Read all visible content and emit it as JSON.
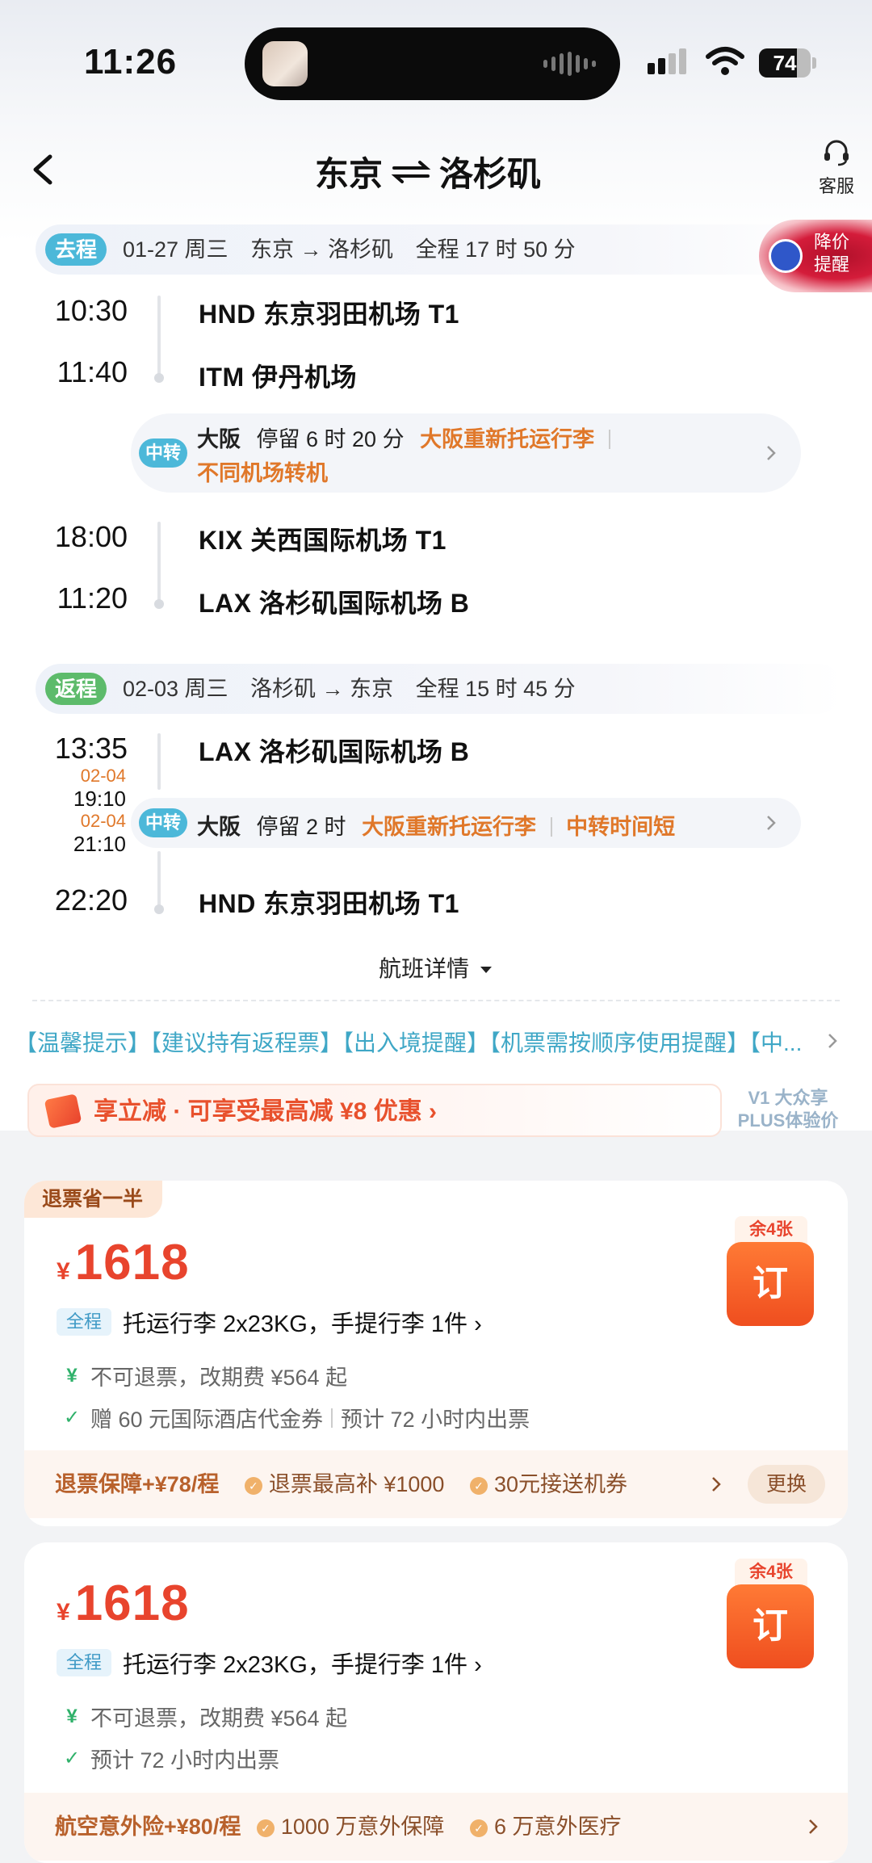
{
  "status": {
    "time": "11:26",
    "battery": "74",
    "battery_level_pct": 74
  },
  "header": {
    "from": "东京",
    "to": "洛杉矶",
    "service_label": "客服"
  },
  "outbound": {
    "badge": "去程",
    "date": "01-27 周三",
    "route": "东京 → 洛杉矶",
    "duration": "全程 17 时 50 分",
    "price_alert": "降价提醒",
    "stops": [
      {
        "time": "10:30",
        "airport": "HND 东京羽田机场 T1"
      },
      {
        "time": "11:40",
        "airport": "ITM 伊丹机场"
      },
      {
        "time": "18:00",
        "airport": "KIX 关西国际机场 T1"
      },
      {
        "time": "11:20",
        "airport": "LAX 洛杉矶国际机场 B"
      }
    ],
    "transfer": {
      "badge": "中转",
      "city": "大阪",
      "stay": "停留 6 时 20 分",
      "note1": "大阪重新托运行李",
      "note2": "不同机场转机"
    }
  },
  "inbound": {
    "badge": "返程",
    "date": "02-03 周三",
    "route": "洛杉矶 → 东京",
    "duration": "全程 15 时 45 分",
    "stops": [
      {
        "time": "13:35",
        "airport": "LAX 洛杉矶国际机场 B"
      },
      {
        "time": "22:20",
        "airport": "HND 东京羽田机场 T1"
      }
    ],
    "transfer": {
      "badge": "中转",
      "city": "大阪",
      "stay": "停留 2 时",
      "note1": "大阪重新托运行李",
      "note2": "中转时间短",
      "arr_date": "02-04",
      "arr_time": "19:10",
      "dep_date": "02-04",
      "dep_time": "21:10"
    }
  },
  "details_toggle": "航班详情",
  "tips": "【温馨提示】【建议持有返程票】【出入境提醒】【机票需按顺序使用提醒】【中...",
  "promo": {
    "text": "享立减 · 可享受最高减 ¥8 优惠 ›",
    "plus": "V1 大众享 PLUS体验价"
  },
  "offers": [
    {
      "tag": "退票省一半",
      "currency": "¥",
      "price": "1618",
      "remain": "余4张",
      "book": "订",
      "fare_badge": "全程",
      "baggage": "托运行李 2x23KG，手提行李 1件 ›",
      "rule1": "不可退票，改期费 ¥564 起",
      "rule2a": "赠 60 元国际酒店代金券",
      "rule2b": "预计 72 小时内出票",
      "ins_lead": "退票保障+¥78/程",
      "ins_item1": "退票最高补 ¥1000",
      "ins_item2": "30元接送机券",
      "change": "更换"
    },
    {
      "currency": "¥",
      "price": "1618",
      "remain": "余4张",
      "book": "订",
      "fare_badge": "全程",
      "baggage": "托运行李 2x23KG，手提行李 1件 ›",
      "rule1": "不可退票，改期费 ¥564 起",
      "rule2": "预计 72 小时内出票",
      "ins_lead": "航空意外险+¥80/程",
      "ins_item1": "1000 万意外保障",
      "ins_item2": "6 万意外医疗"
    }
  ]
}
